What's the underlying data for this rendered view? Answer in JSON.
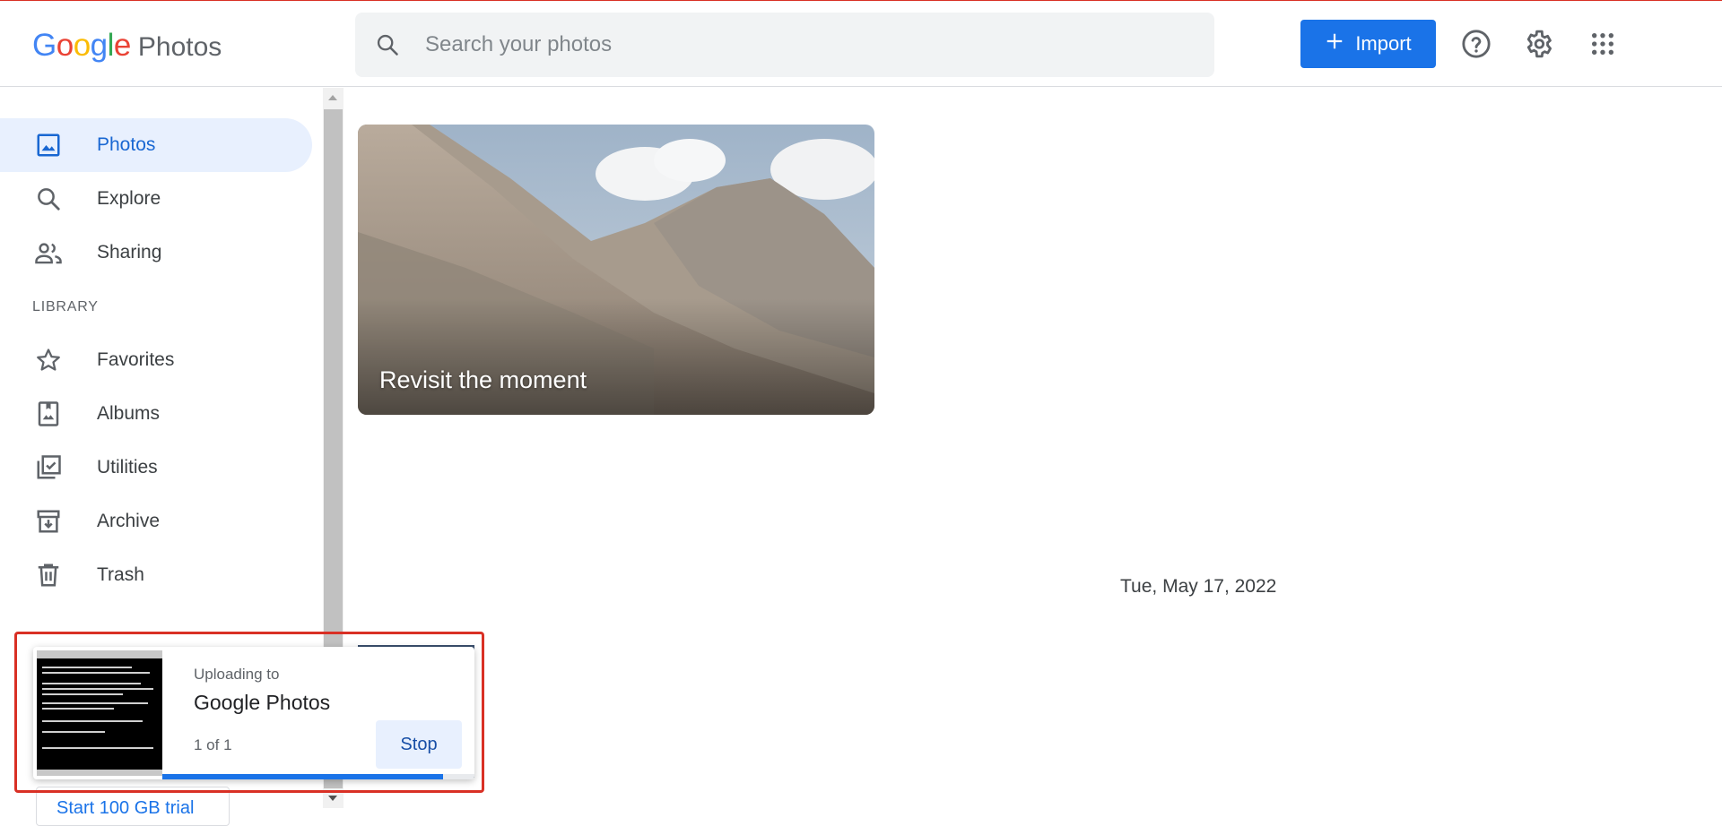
{
  "header": {
    "logo_google": "Google",
    "logo_product": "Photos",
    "search_placeholder": "Search your photos",
    "import_label": "Import"
  },
  "icons": {
    "search": "search-icon",
    "help": "help-circle-icon",
    "settings": "gear-icon",
    "apps": "apps-grid-icon",
    "plus": "plus-icon"
  },
  "sidebar": {
    "items": [
      {
        "label": "Photos",
        "icon": "photo-icon",
        "active": true
      },
      {
        "label": "Explore",
        "icon": "search-icon"
      },
      {
        "label": "Sharing",
        "icon": "people-icon"
      }
    ],
    "library_label": "LIBRARY",
    "library_items": [
      {
        "label": "Favorites",
        "icon": "star-icon"
      },
      {
        "label": "Albums",
        "icon": "album-icon"
      },
      {
        "label": "Utilities",
        "icon": "utilities-icon"
      },
      {
        "label": "Archive",
        "icon": "archive-icon"
      },
      {
        "label": "Trash",
        "icon": "trash-icon"
      }
    ],
    "trial_label": "Start 100 GB trial"
  },
  "main": {
    "memory_caption": "Revisit the moment",
    "date_header": "Tue, May 17, 2022"
  },
  "upload": {
    "subtitle": "Uploading to",
    "title": "Google Photos",
    "count": "1 of 1",
    "stop_label": "Stop",
    "progress": 0.9
  },
  "colors": {
    "accent": "#1a73e8",
    "active_bg": "#e8f0fe",
    "highlight": "#d93025"
  }
}
